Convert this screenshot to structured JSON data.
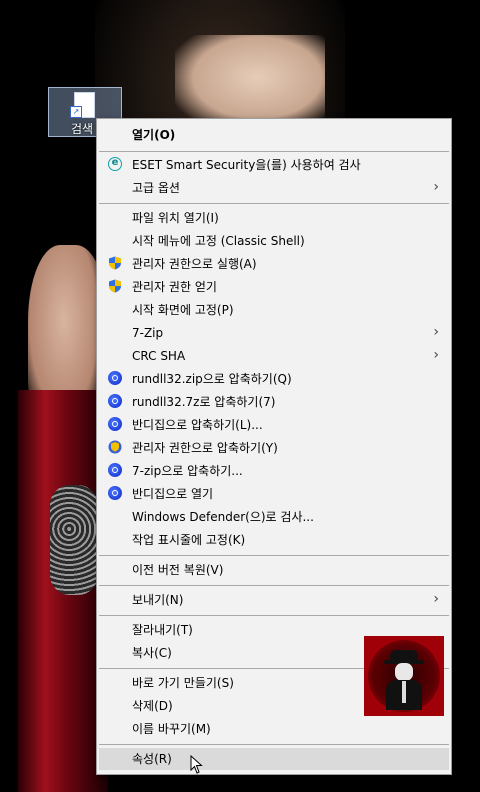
{
  "desktop": {
    "icon_label": "검색"
  },
  "menu": {
    "items": [
      {
        "label": "열기(O)"
      },
      {
        "label": "ESET Smart Security을(를) 사용하여 검사"
      },
      {
        "label": "고급 옵션"
      },
      {
        "label": "파일 위치 열기(I)"
      },
      {
        "label": "시작 메뉴에 고정 (Classic Shell)"
      },
      {
        "label": "관리자 권한으로 실행(A)"
      },
      {
        "label": "관리자 권한 얻기"
      },
      {
        "label": "시작 화면에 고정(P)"
      },
      {
        "label": "7-Zip"
      },
      {
        "label": "CRC SHA"
      },
      {
        "label": "rundll32.zip으로 압축하기(Q)"
      },
      {
        "label": "rundll32.7z로 압축하기(7)"
      },
      {
        "label": "반디집으로 압축하기(L)..."
      },
      {
        "label": "관리자 권한으로 압축하기(Y)"
      },
      {
        "label": "7-zip으로 압축하기..."
      },
      {
        "label": "반디집으로 열기"
      },
      {
        "label": "Windows Defender(으)로 검사..."
      },
      {
        "label": "작업 표시줄에 고정(K)"
      },
      {
        "label": "이전 버전 복원(V)"
      },
      {
        "label": "보내기(N)"
      },
      {
        "label": "잘라내기(T)"
      },
      {
        "label": "복사(C)"
      },
      {
        "label": "바로 가기 만들기(S)"
      },
      {
        "label": "삭제(D)"
      },
      {
        "label": "이름 바꾸기(M)"
      },
      {
        "label": "속성(R)"
      }
    ]
  },
  "icons": {
    "eset": "eset-icon",
    "shield": "uac-shield-icon",
    "zip": "bandizip-icon",
    "submenu": "chevron-right-icon"
  },
  "colors": {
    "menu_bg": "#f2f2f2",
    "hover_bg": "#dadada",
    "eset_teal": "#0aa2a8",
    "zip_blue": "#1e3fd8"
  }
}
